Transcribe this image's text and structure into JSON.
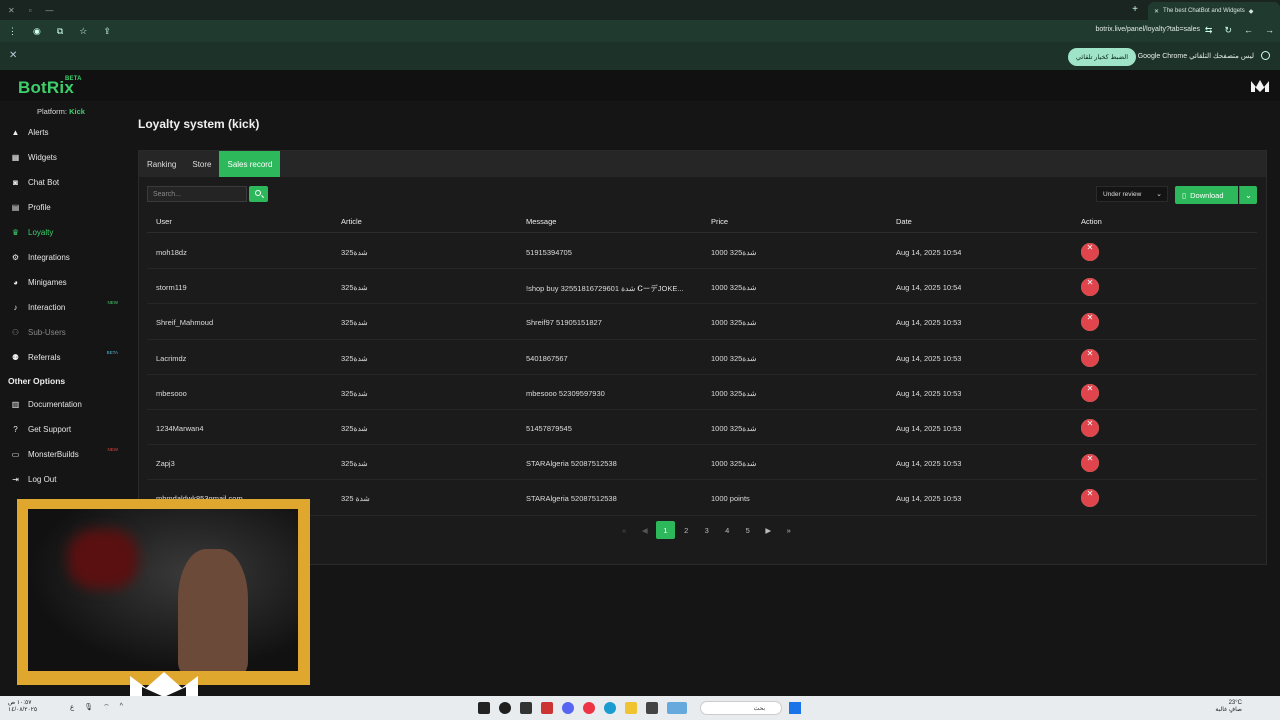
{
  "browser": {
    "tab_title": "The best ChatBot and Widgets",
    "url": "botrix.live/panel/loyalty?tab=sales",
    "infobar_message": "Google Chrome ليس متصفحك التلقائي",
    "infobar_button": "الضبط كخيار تلقائي"
  },
  "app": {
    "brand": "BotRix",
    "brand_badge": "BETA",
    "platform_label": "Platform:",
    "platform_value": "Kick",
    "page_title": "Loyalty system (kick)"
  },
  "sidebar": {
    "items": [
      {
        "label": "Alerts",
        "icon": "warning-icon"
      },
      {
        "label": "Widgets",
        "icon": "grid-icon"
      },
      {
        "label": "Chat Bot",
        "icon": "robot-icon"
      },
      {
        "label": "Profile",
        "icon": "id-card-icon"
      },
      {
        "label": "Loyalty",
        "icon": "trophy-icon",
        "active": true
      },
      {
        "label": "Integrations",
        "icon": "plug-icon"
      },
      {
        "label": "Minigames",
        "icon": "gamepad-icon"
      },
      {
        "label": "Interaction",
        "icon": "music-note-icon",
        "tag": "NEW"
      },
      {
        "label": "Sub-Users",
        "icon": "users-icon"
      },
      {
        "label": "Referrals",
        "icon": "people-icon",
        "tag": "BETA"
      }
    ],
    "other_heading": "Other Options",
    "other_items": [
      {
        "label": "Documentation",
        "icon": "book-icon"
      },
      {
        "label": "Get Support",
        "icon": "question-icon"
      },
      {
        "label": "MonsterBuilds",
        "icon": "monitor-icon",
        "tag": "NEW"
      },
      {
        "label": "Log Out",
        "icon": "logout-icon"
      }
    ]
  },
  "tabs": [
    "Ranking",
    "Store",
    "Sales record"
  ],
  "toolbar": {
    "search_placeholder": "Search...",
    "filter_value": "Under review",
    "download_label": "Download"
  },
  "table": {
    "headers": [
      "User",
      "Article",
      "Message",
      "Price",
      "Date",
      "Action"
    ],
    "rows": [
      {
        "user": "moh18dz",
        "article": "325شدة",
        "message": "51915394705",
        "price": "1000 325شدة",
        "date": "Aug 14, 2025 10:54"
      },
      {
        "user": "storm119",
        "article": "325شدة",
        "message": "!shop buy 32551816729601 شدة 𝐂ーデJOKE...",
        "price": "1000 325شدة",
        "date": "Aug 14, 2025 10:54"
      },
      {
        "user": "Shreif_Mahmoud",
        "article": "325شدة",
        "message": "Shreif97 51905151827",
        "price": "1000 325شدة",
        "date": "Aug 14, 2025 10:53"
      },
      {
        "user": "Lacrimdz",
        "article": "325شدة",
        "message": "5401867567",
        "price": "1000 325شدة",
        "date": "Aug 14, 2025 10:53"
      },
      {
        "user": "mbesooo",
        "article": "325شدة",
        "message": "mbesooo 52309597930",
        "price": "1000 325شدة",
        "date": "Aug 14, 2025 10:53"
      },
      {
        "user": "1234Marwan4",
        "article": "325شدة",
        "message": "51457879545",
        "price": "1000 325شدة",
        "date": "Aug 14, 2025 10:53"
      },
      {
        "user": "Zapj3",
        "article": "325شدة",
        "message": "STARAlgeria 52087512538",
        "price": "1000 325شدة",
        "date": "Aug 14, 2025 10:53"
      },
      {
        "user": "mhmdaldwk853gmail.com",
        "article": "325 شدة",
        "message": "STARAlgeria 52087512538",
        "price": "1000 points",
        "date": "Aug 14, 2025 10:53"
      }
    ]
  },
  "pagination": {
    "pages": [
      "1",
      "2",
      "3",
      "4",
      "5"
    ],
    "current": "1"
  },
  "taskbar": {
    "search_text": "بحث",
    "weather_temp": "23°C",
    "weather_desc": "صافٍ غالبة",
    "clock_time": "١٠:٥٧ ص",
    "clock_date": "١٤/٠٨/٢٠٢٥"
  },
  "colors": {
    "accent": "#2eb85c",
    "danger": "#e0454e",
    "neutral": "#6b7278",
    "cam_frame": "#e0a72e"
  }
}
